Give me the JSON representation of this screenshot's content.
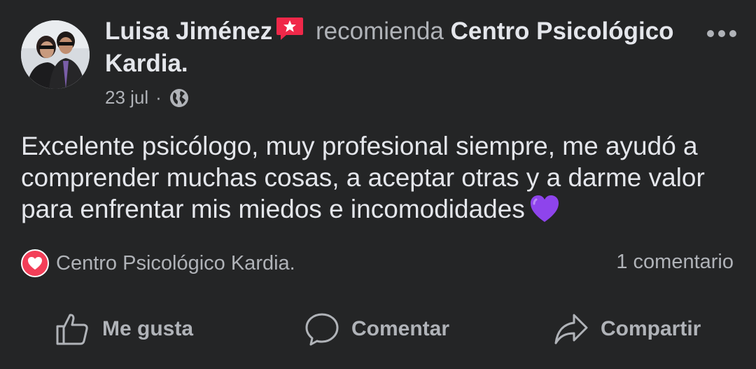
{
  "post": {
    "author": "Luisa Jiménez",
    "action_text": "recomienda",
    "page_name": "Centro Psicológico Kardia.",
    "date": "23 jul",
    "separator": "·",
    "privacy_icon": "globe-icon",
    "recommend_badge_icon": "recommend-star-icon",
    "body": "Excelente psicólogo, muy profesional siempre, me ayudó a comprender muchas cosas, a aceptar otras y a darme valor para enfrentar mis miedos e incomodidades",
    "emoji": "purple-heart-emoji"
  },
  "reactions": {
    "icon": "love-reaction-icon",
    "names": "Centro Psicológico Kardia.",
    "comment_count": "1 comentario"
  },
  "actions": {
    "like": "Me gusta",
    "comment": "Comentar",
    "share": "Compartir"
  },
  "colors": {
    "background": "#242526",
    "primary_text": "#e4e6eb",
    "secondary_text": "#b0b3b8",
    "recommend_badge": "#f02849",
    "love_reaction": "#f33e58",
    "purple_heart": "#8e44ec"
  }
}
